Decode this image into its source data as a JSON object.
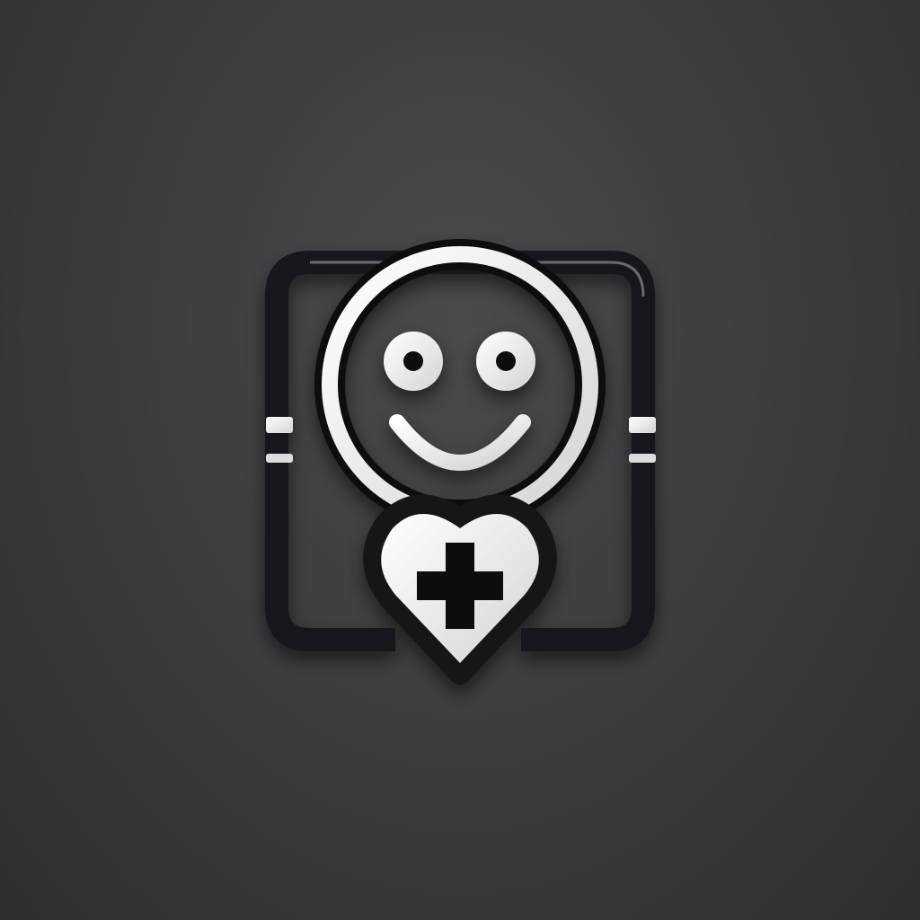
{
  "logo": {
    "name": "smiley-health-app-icon",
    "colors": {
      "background": "#3b3b3d",
      "frame": "#1c1c1e",
      "foreground": "#ececec",
      "cross": "#111111"
    }
  }
}
